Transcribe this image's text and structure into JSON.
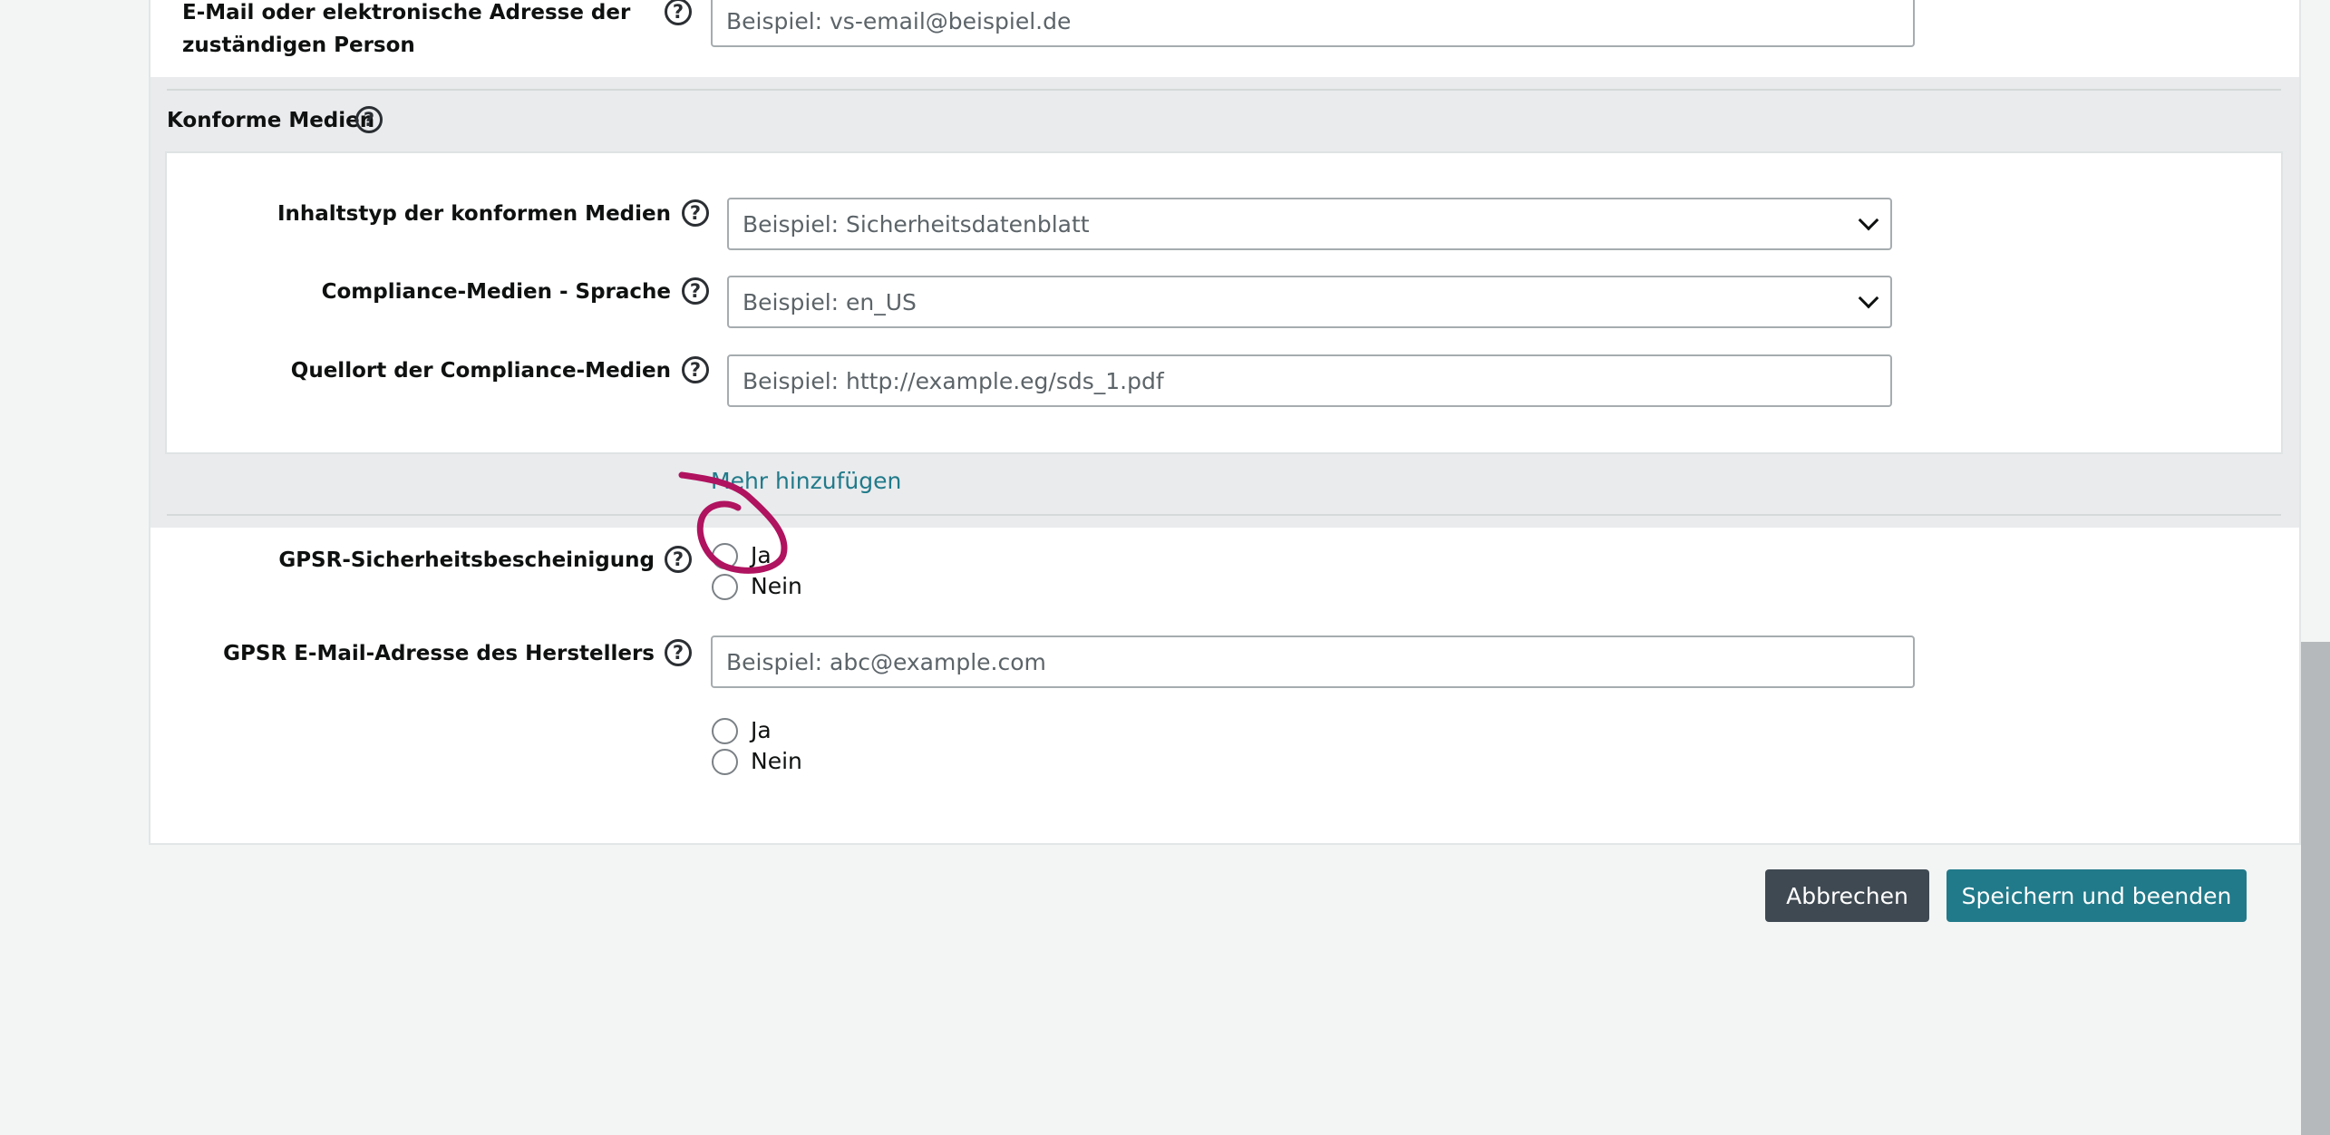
{
  "email_section": {
    "label_line1": "E-Mail oder elektronische Adresse der",
    "label_line2": "zuständigen Person",
    "placeholder": "Beispiel: vs-email@beispiel.de"
  },
  "compliance_media": {
    "title": "Konforme Medien",
    "content_type": {
      "label": "Inhaltstyp der konformen Medien",
      "placeholder": "Beispiel: Sicherheitsdatenblatt"
    },
    "language": {
      "label": "Compliance-Medien - Sprache",
      "placeholder": "Beispiel: en_US"
    },
    "source_location": {
      "label": "Quellort der Compliance-Medien",
      "placeholder": "Beispiel: http://example.eg/sds_1.pdf"
    },
    "add_more_label": "Mehr hinzufügen"
  },
  "gpsr_certificate": {
    "label": "GPSR-Sicherheitsbescheinigung",
    "options": [
      "Ja",
      "Nein"
    ]
  },
  "gpsr_email": {
    "label": "GPSR E-Mail-Adresse des Herstellers",
    "placeholder": "Beispiel: abc@example.com",
    "options": [
      "Ja",
      "Nein"
    ]
  },
  "help_glyph": "?",
  "actions": {
    "cancel_label": "Abbrechen",
    "save_label": "Speichern und beenden"
  },
  "annotation": {
    "color": "#b0135f"
  },
  "colors": {
    "accent": "#217a8a",
    "cancel_button": "#3f4952",
    "page_background": "#f3f5f5"
  }
}
